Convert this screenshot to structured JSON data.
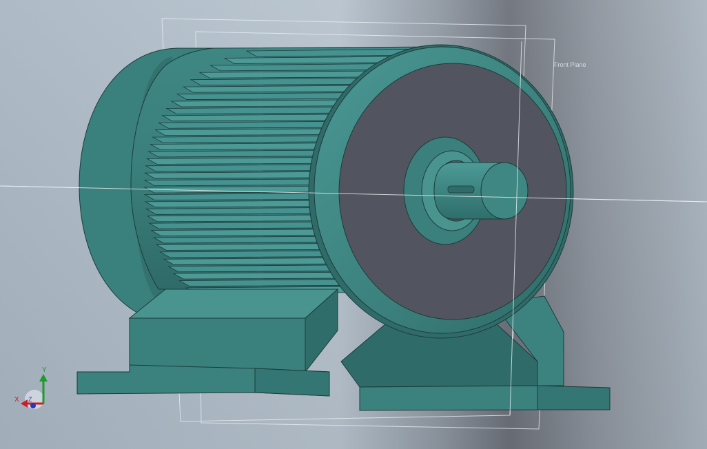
{
  "viewport": {
    "plane_label": "Front Plane"
  },
  "triad": {
    "x_label": "X",
    "y_label": "Y",
    "z_label": "Z"
  },
  "colors": {
    "model_teal": "#3f8a86",
    "end_cap": "#52555f",
    "x_axis": "#c8202a",
    "y_axis": "#1f9a2c",
    "z_axis": "#2836b8"
  }
}
